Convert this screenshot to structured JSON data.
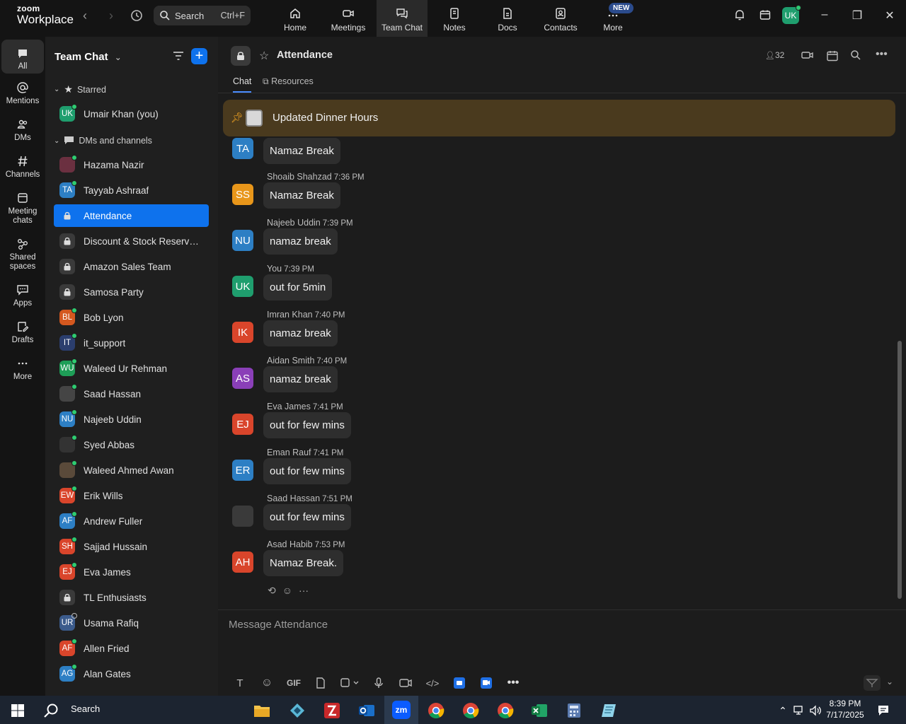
{
  "app": {
    "logo_top": "zoom",
    "logo_bottom": "Workplace"
  },
  "search": {
    "label": "Search",
    "shortcut": "Ctrl+F"
  },
  "top_tabs": [
    {
      "label": "Home"
    },
    {
      "label": "Meetings"
    },
    {
      "label": "Team Chat"
    },
    {
      "label": "Notes"
    },
    {
      "label": "Docs"
    },
    {
      "label": "Contacts"
    },
    {
      "label": "More"
    }
  ],
  "new_badge": "NEW",
  "user_initials": "UK",
  "rail": [
    {
      "label": "All"
    },
    {
      "label": "Mentions"
    },
    {
      "label": "DMs"
    },
    {
      "label": "Channels"
    },
    {
      "label": "Meeting chats"
    },
    {
      "label": "Shared spaces"
    },
    {
      "label": "Apps"
    },
    {
      "label": "Drafts"
    },
    {
      "label": "More"
    }
  ],
  "sidebar": {
    "title": "Team Chat",
    "starred_label": "Starred",
    "dms_label": "DMs and channels",
    "starred": [
      {
        "initials": "UK",
        "name": "Umair Khan (you)",
        "color": "#1f9e6e"
      }
    ],
    "items": [
      {
        "initials": "",
        "name": "Hazama Nazir",
        "color": "#6b3040"
      },
      {
        "initials": "TA",
        "name": "Tayyab Ashraaf",
        "color": "#2d7fc4"
      },
      {
        "initials": "",
        "name": "Attendance",
        "lock": true,
        "selected": true
      },
      {
        "initials": "",
        "name": "Discount & Stock Reservati...",
        "lock": true
      },
      {
        "initials": "",
        "name": "Amazon Sales Team",
        "lock": true
      },
      {
        "initials": "",
        "name": "Samosa Party",
        "lock": true
      },
      {
        "initials": "BL",
        "name": "Bob Lyon",
        "color": "#d4581f"
      },
      {
        "initials": "IT",
        "name": "it_support",
        "color": "#2b3e6e"
      },
      {
        "initials": "WU",
        "name": "Waleed Ur Rehman",
        "color": "#1e9e57"
      },
      {
        "initials": "",
        "name": "Saad Hassan",
        "color": "#454545"
      },
      {
        "initials": "NU",
        "name": "Najeeb Uddin",
        "color": "#2d7fc4"
      },
      {
        "initials": "",
        "name": "Syed Abbas",
        "color": "#333333"
      },
      {
        "initials": "",
        "name": "Waleed Ahmed Awan",
        "color": "#5a4a3a"
      },
      {
        "initials": "EW",
        "name": "Erik Wills",
        "color": "#d9452b"
      },
      {
        "initials": "AF",
        "name": "Andrew Fuller",
        "color": "#2d7fc4"
      },
      {
        "initials": "SH",
        "name": "Sajjad Hussain",
        "color": "#d9452b"
      },
      {
        "initials": "EJ",
        "name": "Eva James",
        "color": "#d9452b"
      },
      {
        "initials": "",
        "name": "TL Enthusiasts",
        "lock": true
      },
      {
        "initials": "UR",
        "name": "Usama Rafiq",
        "color": "#3b5b8c"
      },
      {
        "initials": "AF",
        "name": "Allen Fried",
        "color": "#d9452b"
      },
      {
        "initials": "AG",
        "name": "Alan Gates",
        "color": "#2d7fc4"
      }
    ]
  },
  "channel": {
    "name": "Attendance",
    "members": "32",
    "tabs": [
      {
        "label": "Chat"
      },
      {
        "label": "Resources"
      }
    ],
    "pinned": "Updated Dinner Hours",
    "composer_placeholder": "Message Attendance",
    "gif_label": "GIF"
  },
  "messages": [
    {
      "initials": "TA",
      "color": "#2d7fc4",
      "sender": "",
      "time": "",
      "text": "Namaz Break"
    },
    {
      "initials": "SS",
      "color": "#e8961a",
      "sender": "Shoaib Shahzad",
      "time": "7:36 PM",
      "text": "Namaz Break"
    },
    {
      "initials": "NU",
      "color": "#2d7fc4",
      "sender": "Najeeb Uddin",
      "time": "7:39 PM",
      "text": "namaz break"
    },
    {
      "initials": "UK",
      "color": "#1f9e6e",
      "sender": "You",
      "time": "7:39 PM",
      "text": "out for 5min"
    },
    {
      "initials": "IK",
      "color": "#d9452b",
      "sender": "Imran Khan",
      "time": "7:40 PM",
      "text": "namaz break"
    },
    {
      "initials": "AS",
      "color": "#8a3fb8",
      "sender": "Aidan Smith",
      "time": "7:40 PM",
      "text": "namaz break"
    },
    {
      "initials": "EJ",
      "color": "#d9452b",
      "sender": "Eva James",
      "time": "7:41 PM",
      "text": "out for few mins"
    },
    {
      "initials": "ER",
      "color": "#2d7fc4",
      "sender": "Eman Rauf",
      "time": "7:41 PM",
      "text": "out for few mins"
    },
    {
      "initials": "",
      "color": "#3a3a3a",
      "sender": "Saad Hassan",
      "time": "7:51 PM",
      "text": "out for few  mins"
    },
    {
      "initials": "AH",
      "color": "#d9452b",
      "sender": "Asad Habib",
      "time": "7:53 PM",
      "text": "Namaz Break."
    }
  ],
  "taskbar": {
    "search_label": "Search",
    "time": "8:39 PM",
    "date": "7/17/2025",
    "zoom_label": "zm"
  }
}
